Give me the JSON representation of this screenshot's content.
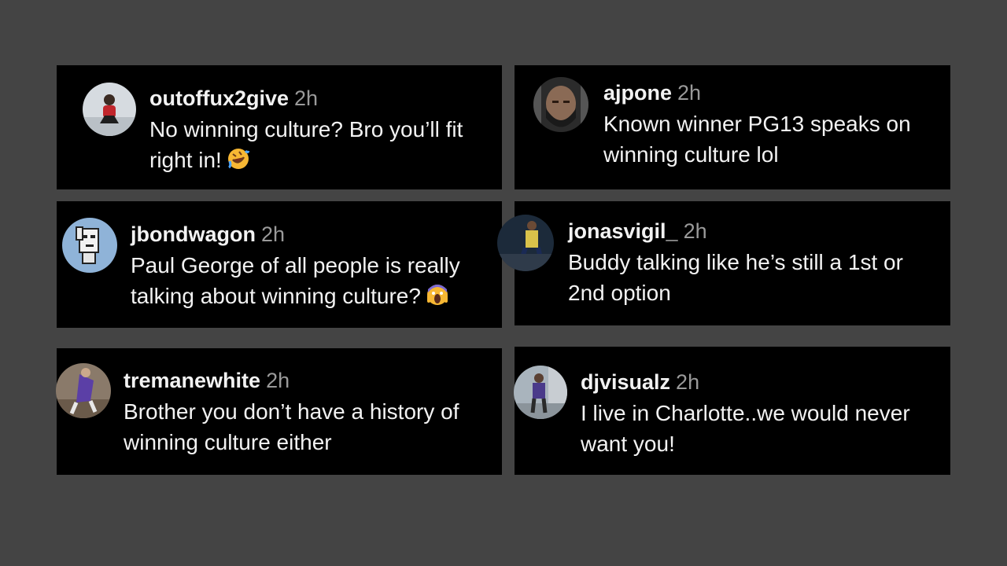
{
  "comments": [
    {
      "username": "outoffux2give",
      "time": "2h",
      "text": "No winning culture? Bro you’ll fit right in!",
      "emoji": "rolling-on-floor-laughing-emoji"
    },
    {
      "username": "ajpone",
      "time": "2h",
      "text": "Known winner PG13 speaks on winning culture lol"
    },
    {
      "username": "jbondwagon",
      "time": "2h",
      "text": "Paul George of all people is really talking about winning culture?",
      "emoji": "face-screaming-in-fear-emoji"
    },
    {
      "username": "jonasvigil_",
      "time": "2h",
      "text": "Buddy talking like he’s still a 1st or 2nd option"
    },
    {
      "username": "tremanewhite",
      "time": "2h",
      "text": "Brother you don’t have a history of winning culture either"
    },
    {
      "username": "djvisualz",
      "time": "2h",
      "text": "I live in Charlotte..we would never want you!"
    }
  ],
  "colors": {
    "background": "#444444",
    "card": "#000000",
    "text": "#f2f2f2",
    "timestamp": "#9a9a9a"
  }
}
